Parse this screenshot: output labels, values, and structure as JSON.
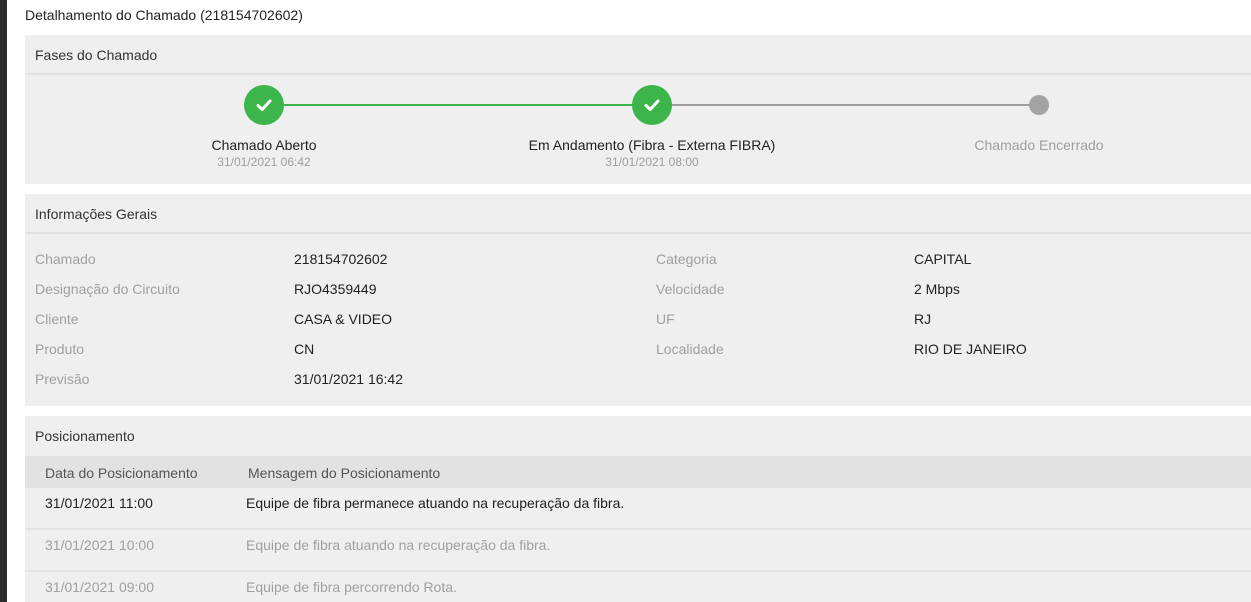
{
  "page": {
    "title": "Detalhamento do Chamado (218154702602)"
  },
  "phases": {
    "header": "Fases do Chamado",
    "steps": [
      {
        "label": "Chamado Aberto",
        "date": "31/01/2021 06:42",
        "status": "done"
      },
      {
        "label": "Em Andamento (Fibra - Externa FIBRA)",
        "date": "31/01/2021 08:00",
        "status": "done"
      },
      {
        "label": "Chamado Encerrado",
        "date": "",
        "status": "pending"
      }
    ],
    "colors": {
      "done": "#3cb54a",
      "pending": "#a3a3a3"
    }
  },
  "info": {
    "header": "Informações Gerais",
    "left": [
      {
        "label": "Chamado",
        "value": "218154702602"
      },
      {
        "label": "Designação do Circuito",
        "value": "RJO4359449"
      },
      {
        "label": "Cliente",
        "value": "CASA & VIDEO"
      },
      {
        "label": "Produto",
        "value": "CN"
      },
      {
        "label": "Previsão",
        "value": "31/01/2021 16:42"
      }
    ],
    "right": [
      {
        "label": "Categoria",
        "value": "CAPITAL"
      },
      {
        "label": "Velocidade",
        "value": "2 Mbps"
      },
      {
        "label": "UF",
        "value": "RJ"
      },
      {
        "label": "Localidade",
        "value": "RIO DE JANEIRO"
      }
    ]
  },
  "positions": {
    "header": "Posicionamento",
    "columns": [
      "Data do Posicionamento",
      "Mensagem do Posicionamento"
    ],
    "rows": [
      {
        "date": "31/01/2021 11:00",
        "message": "Equipe de fibra permanece atuando na recuperação da fibra."
      },
      {
        "date": "31/01/2021 10:00",
        "message": "Equipe de fibra atuando na recuperação da fibra."
      },
      {
        "date": "31/01/2021 09:00",
        "message": "Equipe de fibra percorrendo Rota."
      }
    ]
  },
  "icons": {
    "step_done": "check-icon"
  }
}
